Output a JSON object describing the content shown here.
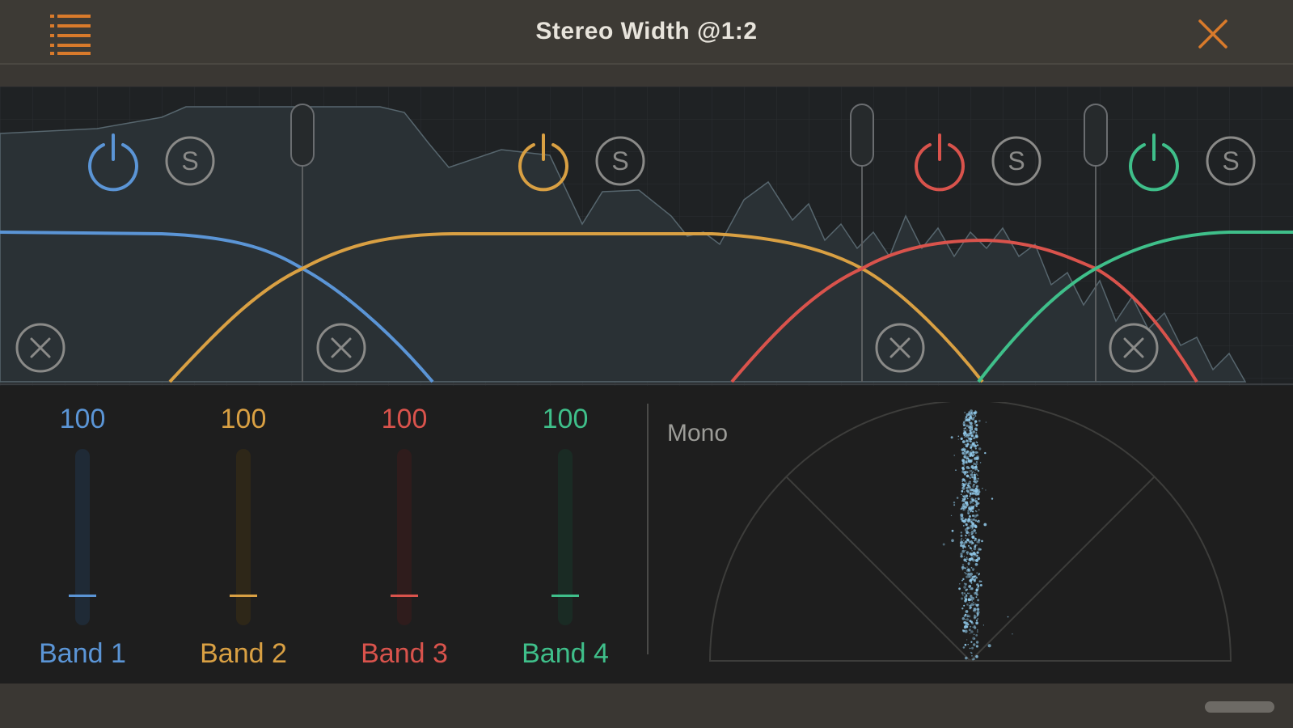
{
  "header": {
    "title": "Stereo Width @1:2",
    "menu_icon": "menu-list-icon",
    "close_icon": "close-icon"
  },
  "colors": {
    "accent": "#d97a2b",
    "band1": "#5b95d6",
    "band2": "#d9a043",
    "band3": "#d9534c",
    "band4": "#3fbf8a"
  },
  "bands": [
    {
      "name": "Band 1",
      "value": "100",
      "width_level": 100
    },
    {
      "name": "Band 2",
      "value": "100",
      "width_level": 100
    },
    {
      "name": "Band 3",
      "value": "100",
      "width_level": 100
    },
    {
      "name": "Band 4",
      "value": "100",
      "width_level": 100
    }
  ],
  "band_controls": {
    "power_icon": "power-icon",
    "solo_label": "S",
    "remove_icon": "remove-circle-icon"
  },
  "scope": {
    "label": "Mono"
  }
}
